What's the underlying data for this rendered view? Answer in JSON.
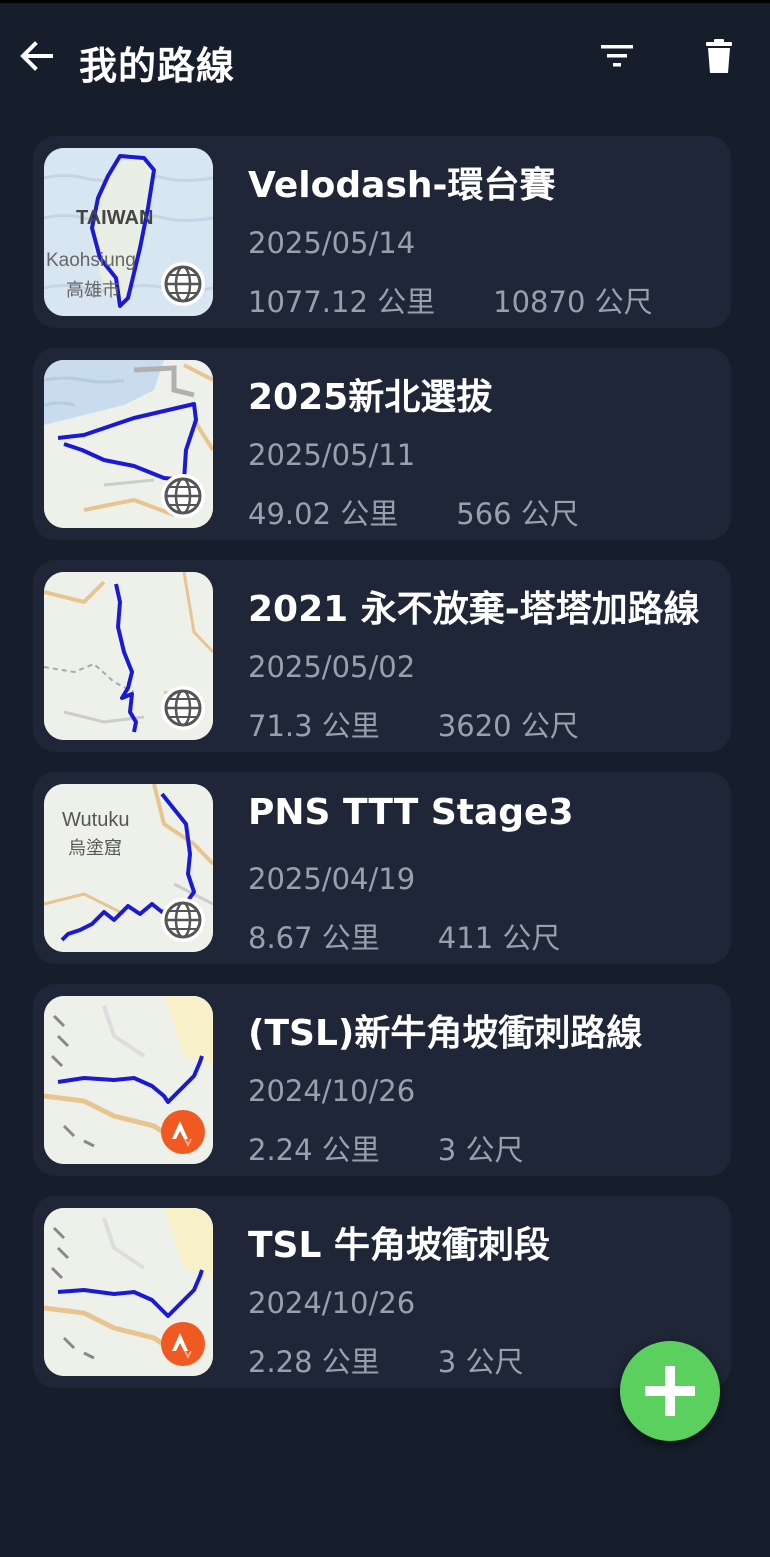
{
  "header": {
    "title": "我的路線",
    "icons": {
      "back": "arrow-left-icon",
      "filter": "filter-icon",
      "delete": "trash-icon"
    }
  },
  "routes": [
    {
      "name": "Velodash-環台賽",
      "date": "2025/05/14",
      "distance": "1077.12 公里",
      "elevation": "10870 公尺",
      "source_icon": "globe-icon",
      "map_labels": [
        "TAIWAN",
        "Kaohsiung",
        "高雄市"
      ]
    },
    {
      "name": "2025新北選拔",
      "date": "2025/05/11",
      "distance": "49.02 公里",
      "elevation": "566 公尺",
      "source_icon": "globe-icon"
    },
    {
      "name": "2021 永不放棄-塔塔加路線",
      "date": "2025/05/02",
      "distance": "71.3 公里",
      "elevation": "3620 公尺",
      "source_icon": "globe-icon"
    },
    {
      "name": "PNS TTT Stage3",
      "date": "2025/04/19",
      "distance": "8.67 公里",
      "elevation": "411 公尺",
      "source_icon": "globe-icon",
      "map_labels": [
        "Wutuku",
        "烏塗窟"
      ]
    },
    {
      "name": "(TSL)新牛角坡衝刺路線",
      "date": "2024/10/26",
      "distance": "2.24 公里",
      "elevation": "3 公尺",
      "source_icon": "strava-icon"
    },
    {
      "name": "TSL 牛角坡衝刺段",
      "date": "2024/10/26",
      "distance": "2.28 公里",
      "elevation": "3 公尺",
      "source_icon": "strava-icon"
    }
  ],
  "fab": {
    "icon": "plus-icon"
  },
  "colors": {
    "background": "#161d2b",
    "card": "#1e2637",
    "route_line": "#1a1ad6",
    "fab": "#5bd05e",
    "strava": "#f05a22",
    "secondary_text": "#9aa0ab"
  }
}
